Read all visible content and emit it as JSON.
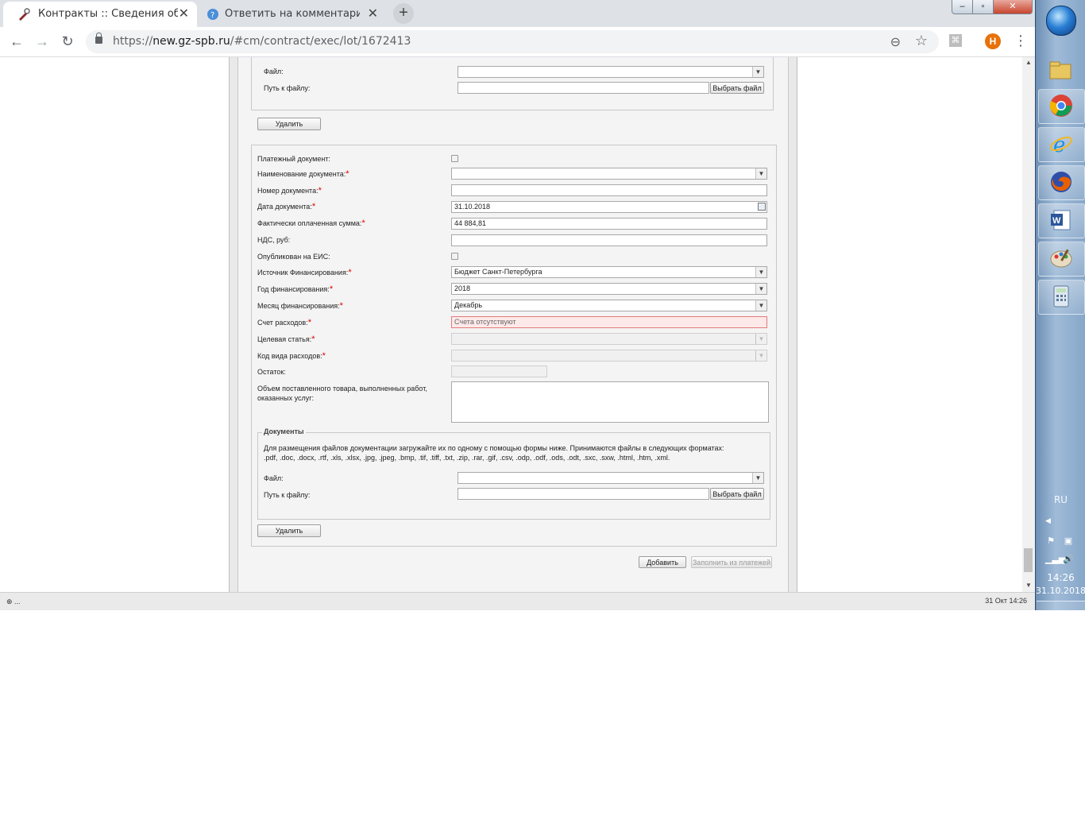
{
  "browser": {
    "tabs": [
      {
        "title": "Контракты :: Сведения об испо",
        "close": "✕"
      },
      {
        "title": "Ответить на комментарий | Hel",
        "close": "✕"
      }
    ],
    "new_tab": "+",
    "url_prefix": "https://",
    "url_host": "new.gz-spb.ru",
    "url_path": "/#cm/contract/exec/lot/1672413",
    "avatar_letter": "Н",
    "window_controls": {
      "minimize": "‒",
      "maximize": "▫",
      "close": "✕"
    }
  },
  "top_file_section": {
    "file_label": "Файл:",
    "path_label": "Путь к файлу:",
    "choose_button": "Выбрать файл",
    "delete_button": "Удалить"
  },
  "payment_form": {
    "payment_doc_label": "Платежный документ:",
    "doc_name_label": "Наименование документа:",
    "doc_number_label": "Номер документа:",
    "doc_date_label": "Дата документа:",
    "doc_date_value": "31.10.2018",
    "paid_sum_label": "Фактически оплаченная сумма:",
    "paid_sum_value": "44 884,81",
    "vat_label": "НДС, руб:",
    "published_label": "Опубликован на ЕИС:",
    "funding_source_label": "Источник Финансирования:",
    "funding_source_value": "Бюджет Санкт-Петербурга",
    "funding_year_label": "Год финансирования:",
    "funding_year_value": "2018",
    "funding_month_label": "Месяц финансирования:",
    "funding_month_value": "Декабрь",
    "expense_account_label": "Счет расходов:",
    "expense_account_value": "Счета отсутствуют",
    "target_article_label": "Целевая статья:",
    "expense_type_label": "Код вида расходов:",
    "remainder_label": "Остаток:",
    "volume_label_1": "Объем поставленного товара, выполненных работ,",
    "volume_label_2": "оказанных услуг:",
    "required_mark": "*"
  },
  "documents_section": {
    "legend": "Документы",
    "hint_1": "Для размещения файлов документации загружайте их по одному с помощью формы ниже. Принимаются файлы в следующих форматах:",
    "hint_2": ".pdf, .doc, .docx, .rtf, .xls, .xlsx, .jpg, .jpeg, .bmp, .tif, .tiff, .txt, .zip, .rar, .gif, .csv, .odp, .odf, .ods, .odt, .sxc, .sxw, .html, .htm, .xml.",
    "file_label": "Файл:",
    "path_label": "Путь к файлу:",
    "choose_button": "Выбрать файл",
    "delete_button": "Удалить"
  },
  "actions": {
    "add_button": "Добавить",
    "fill_from_payments_button": "Заполнить из платежей"
  },
  "statusbar": {
    "left": "⊕ ...",
    "right": "31 Окт 14:26"
  },
  "taskbar": {
    "language": "RU",
    "time": "14:26",
    "date": "31.10.2018",
    "apps": [
      "explorer-icon",
      "chrome-icon",
      "internet-explorer-icon",
      "firefox-icon",
      "word-icon",
      "paint-icon",
      "calculator-icon"
    ]
  }
}
